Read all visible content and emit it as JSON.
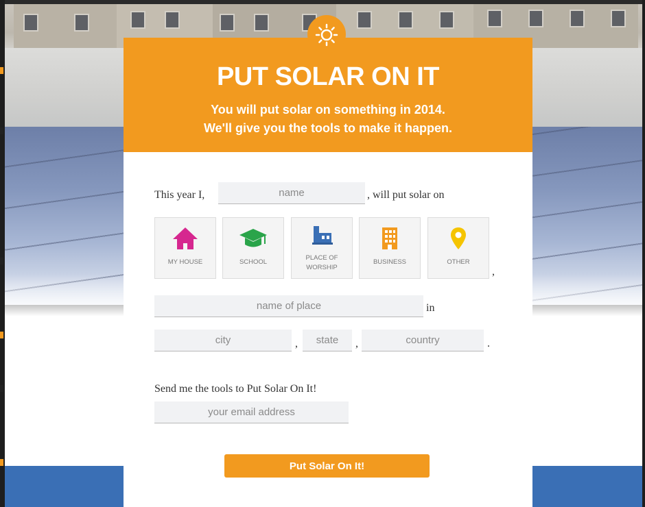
{
  "header": {
    "title": "PUT SOLAR ON IT",
    "subtitle_line1": "You will put solar on something in 2014.",
    "subtitle_line2": "We'll give you the tools to make it happen."
  },
  "sentence": {
    "prefix": "This year I,",
    "name_placeholder": "name",
    "suffix": ", will put solar on",
    "after_options": ",",
    "in": "in",
    "comma1": ",",
    "comma2": ",",
    "period": "."
  },
  "options": [
    {
      "label": "MY HOUSE",
      "icon": "house-icon",
      "color": "#d6278f"
    },
    {
      "label": "SCHOOL",
      "icon": "graduation-cap-icon",
      "color": "#2aa44a"
    },
    {
      "label_line1": "PLACE OF",
      "label_line2": "WORSHIP",
      "icon": "place-of-worship-icon",
      "color": "#3a6fb5"
    },
    {
      "label": "BUSINESS",
      "icon": "building-icon",
      "color": "#f29a1f"
    },
    {
      "label": "OTHER",
      "icon": "map-pin-icon",
      "color": "#f5c400"
    }
  ],
  "place": {
    "name_placeholder": "name of place",
    "city_placeholder": "city",
    "state_placeholder": "state",
    "country_placeholder": "country"
  },
  "email": {
    "prompt": "Send me the tools to Put Solar On It!",
    "placeholder": "your email address"
  },
  "submit_label": "Put Solar On It!",
  "colors": {
    "accent": "#f29a1f",
    "footer_blue": "#3a6fb5"
  }
}
